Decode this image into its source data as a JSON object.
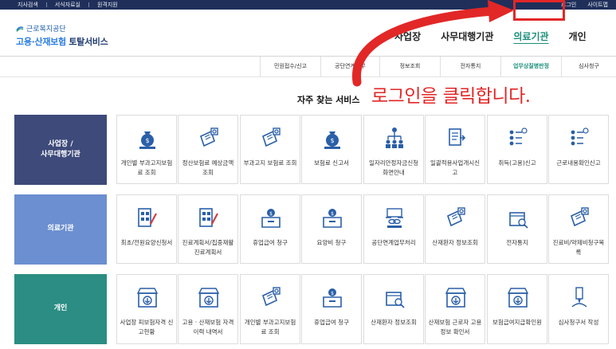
{
  "topbar": {
    "left": [
      "지사검색",
      "서식자료실",
      "원격지원"
    ],
    "right": [
      "로그인",
      "사이트맵"
    ]
  },
  "logo": {
    "org": "근로복지공단",
    "service_accent": "고용·산재보험",
    "service_rest": "토탈서비스"
  },
  "gnb": [
    {
      "label": "사업장",
      "active": false
    },
    {
      "label": "사무대행기관",
      "active": false
    },
    {
      "label": "의료기관",
      "active": true
    },
    {
      "label": "개인",
      "active": false
    }
  ],
  "subnav": [
    "민원접수/신고",
    "공단연계업무",
    "정보조회",
    "전자통지",
    "업무상질병판정",
    "심사청구"
  ],
  "faq_title": "자주 찾는 서비스",
  "callout": "로그인을 클릭합니다.",
  "colors": {
    "accent": "#e22727",
    "navy": "#3d4a7a",
    "blue": "#6b8fd0",
    "teal": "#2b8d83",
    "icon": "#2a5fa8",
    "active": "#1d8f7a"
  },
  "categories": [
    {
      "name": "사업장 /\n사무대행기관",
      "items": [
        {
          "label": "개인별 부과고지보험료 조회",
          "icon": "money-bag-icon"
        },
        {
          "label": "정산보험료 예상금액 조회",
          "icon": "document-search-icon"
        },
        {
          "label": "부과고지 보험료 조회",
          "icon": "document-search-icon"
        },
        {
          "label": "보험료 신고서",
          "icon": "money-bag-icon"
        },
        {
          "label": "일자리안정자금신청화면안내",
          "icon": "people-network-icon"
        },
        {
          "label": "일괄적용사업개시신고",
          "icon": "document-stack-icon"
        },
        {
          "label": "취득(고용)신고",
          "icon": "person-list-icon"
        },
        {
          "label": "근로내용확인신고",
          "icon": "person-list-icon"
        }
      ]
    },
    {
      "name": "의료기관",
      "items": [
        {
          "label": "최초/전원요양신청서",
          "icon": "form-pen-icon"
        },
        {
          "label": "진료계획서/집중재활진료계획서",
          "icon": "form-pen-icon"
        },
        {
          "label": "휴업급여 청구",
          "icon": "inbox-icon"
        },
        {
          "label": "요양비 청구",
          "icon": "inbox-icon"
        },
        {
          "label": "공단연계업무처리",
          "icon": "link-folder-icon"
        },
        {
          "label": "산재환자 정보조회",
          "icon": "document-search-icon"
        },
        {
          "label": "전자통지",
          "icon": "box-search-icon"
        },
        {
          "label": "진료비/약제비청구목록",
          "icon": "document-search-icon"
        }
      ]
    },
    {
      "name": "개인",
      "items": [
        {
          "label": "사업장 피보험자격 신고현황",
          "icon": "download-box-icon"
        },
        {
          "label": "고용 · 산재보험 자격 이력 내역서",
          "icon": "download-box-icon"
        },
        {
          "label": "개인별 부과고지보험료 조회",
          "icon": "document-search-icon"
        },
        {
          "label": "휴업급여 청구",
          "icon": "inbox-icon"
        },
        {
          "label": "산재환자 정보조회",
          "icon": "box-search-icon"
        },
        {
          "label": "산재보험 근로자 고용정보 확인서",
          "icon": "download-box-icon"
        },
        {
          "label": "보험급여지급확인원",
          "icon": "download-box-icon"
        },
        {
          "label": "심사청구서 작성",
          "icon": "pen-paper-icon"
        }
      ]
    }
  ]
}
